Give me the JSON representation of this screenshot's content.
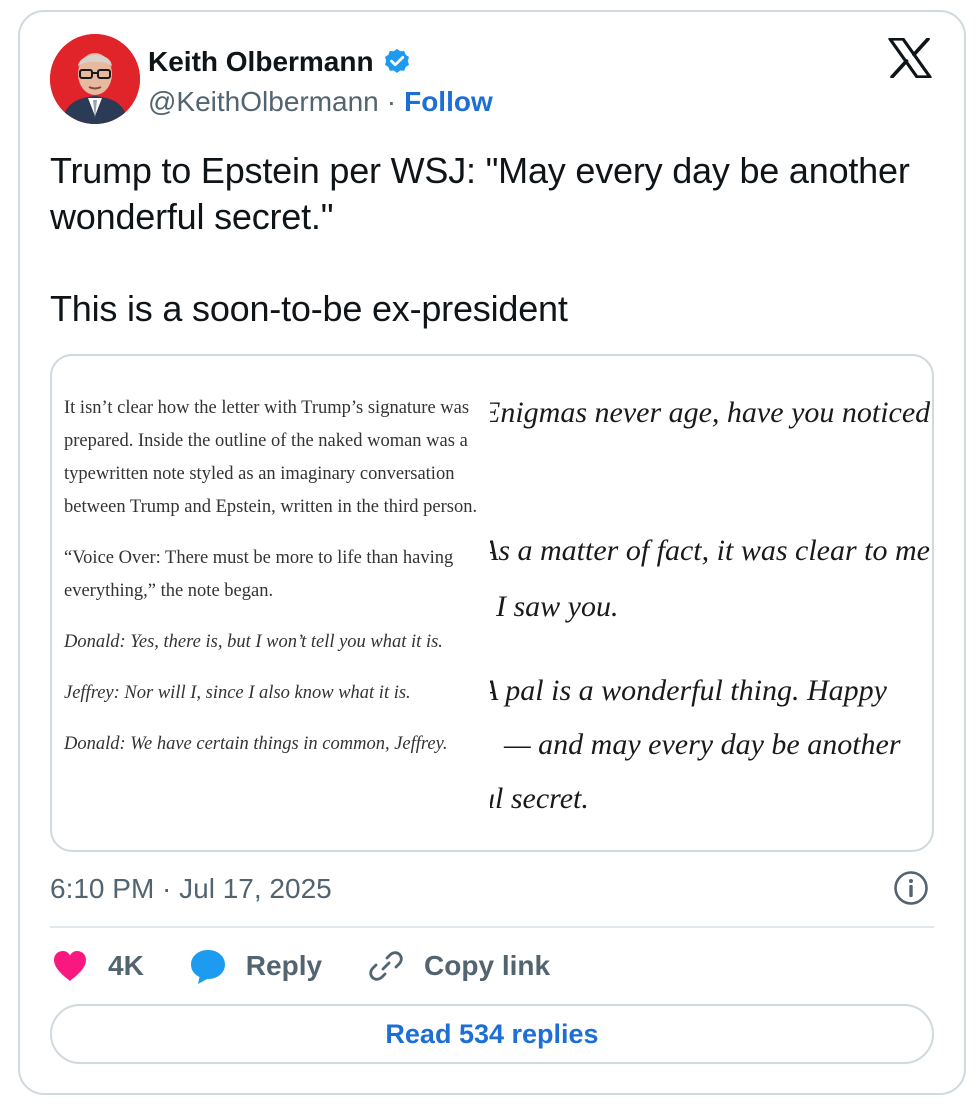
{
  "author": {
    "name": "Keith Olbermann",
    "handle": "@KeithOlbermann",
    "separator": "·",
    "follow_label": "Follow",
    "verified_icon": "verified-badge-icon",
    "avatar_bg": "#e0242a"
  },
  "tweet": {
    "paragraphs": [
      "Trump to Epstein per WSJ: \"May every day be another wonderful secret.\"",
      "This is a soon-to-be ex-president"
    ]
  },
  "media": {
    "left_paragraphs": [
      {
        "text": "It isn’t clear how the letter with Trump’s signature was prepared. Inside the outline of the naked woman was a typewritten note styled as an imaginary conversation between Trump and Epstein, written in the third person.",
        "italic": false
      },
      {
        "text": "“Voice Over: There must be more to life than having everything,” the note began.",
        "italic": false
      },
      {
        "text": "Donald: Yes, there is, but I won’t tell you what it is.",
        "italic": true
      },
      {
        "text": "Jeffrey: Nor will I, since I also know what it is.",
        "italic": true
      },
      {
        "text": "Donald: We have certain things in common, Jeffrey.",
        "italic": true
      }
    ],
    "right_lines": [
      "Enigmas never age, have you noticed",
      "As a matter of fact, it was clear to me",
      "I saw you.",
      "A pal is a wonderful thing. Happy",
      "— and may every day be another",
      "ul secret."
    ]
  },
  "timestamp": "6:10 PM · Jul 17, 2025",
  "actions": {
    "like_count": "4K",
    "reply_label": "Reply",
    "copy_label": "Copy link"
  },
  "read_replies_label": "Read 534 replies",
  "colors": {
    "accent": "#1d6fd6",
    "like": "#f91880",
    "reply": "#1d9bf0",
    "muted": "#536471",
    "border": "#cfd9de"
  }
}
